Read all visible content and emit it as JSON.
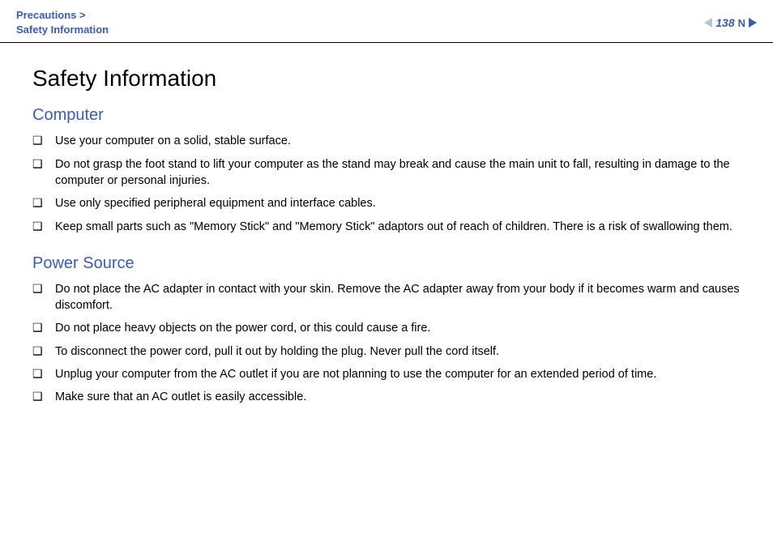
{
  "header": {
    "breadcrumb_line1": "Precautions >",
    "breadcrumb_line2": "Safety Information",
    "page_number": "138"
  },
  "title": "Safety Information",
  "sections": [
    {
      "heading": "Computer",
      "items": [
        "Use your computer on a solid, stable surface.",
        "Do not grasp the foot stand to lift your computer as the stand may break and cause the main unit to fall, resulting in damage to the computer or personal injuries.",
        "Use only specified peripheral equipment and interface cables.",
        "Keep small parts such as \"Memory Stick\" and \"Memory Stick\" adaptors out of reach of children. There is a risk of swallowing them."
      ]
    },
    {
      "heading": "Power Source",
      "items": [
        "Do not place the AC adapter in contact with your skin. Remove the AC adapter away from your body if it becomes warm and causes discomfort.",
        "Do not place heavy objects on the power cord, or this could cause a fire.",
        "To disconnect the power cord, pull it out by holding the plug. Never pull the cord itself.",
        "Unplug your computer from the AC outlet if you are not planning to use the computer for an extended period of time.",
        "Make sure that an AC outlet is easily accessible."
      ]
    }
  ]
}
